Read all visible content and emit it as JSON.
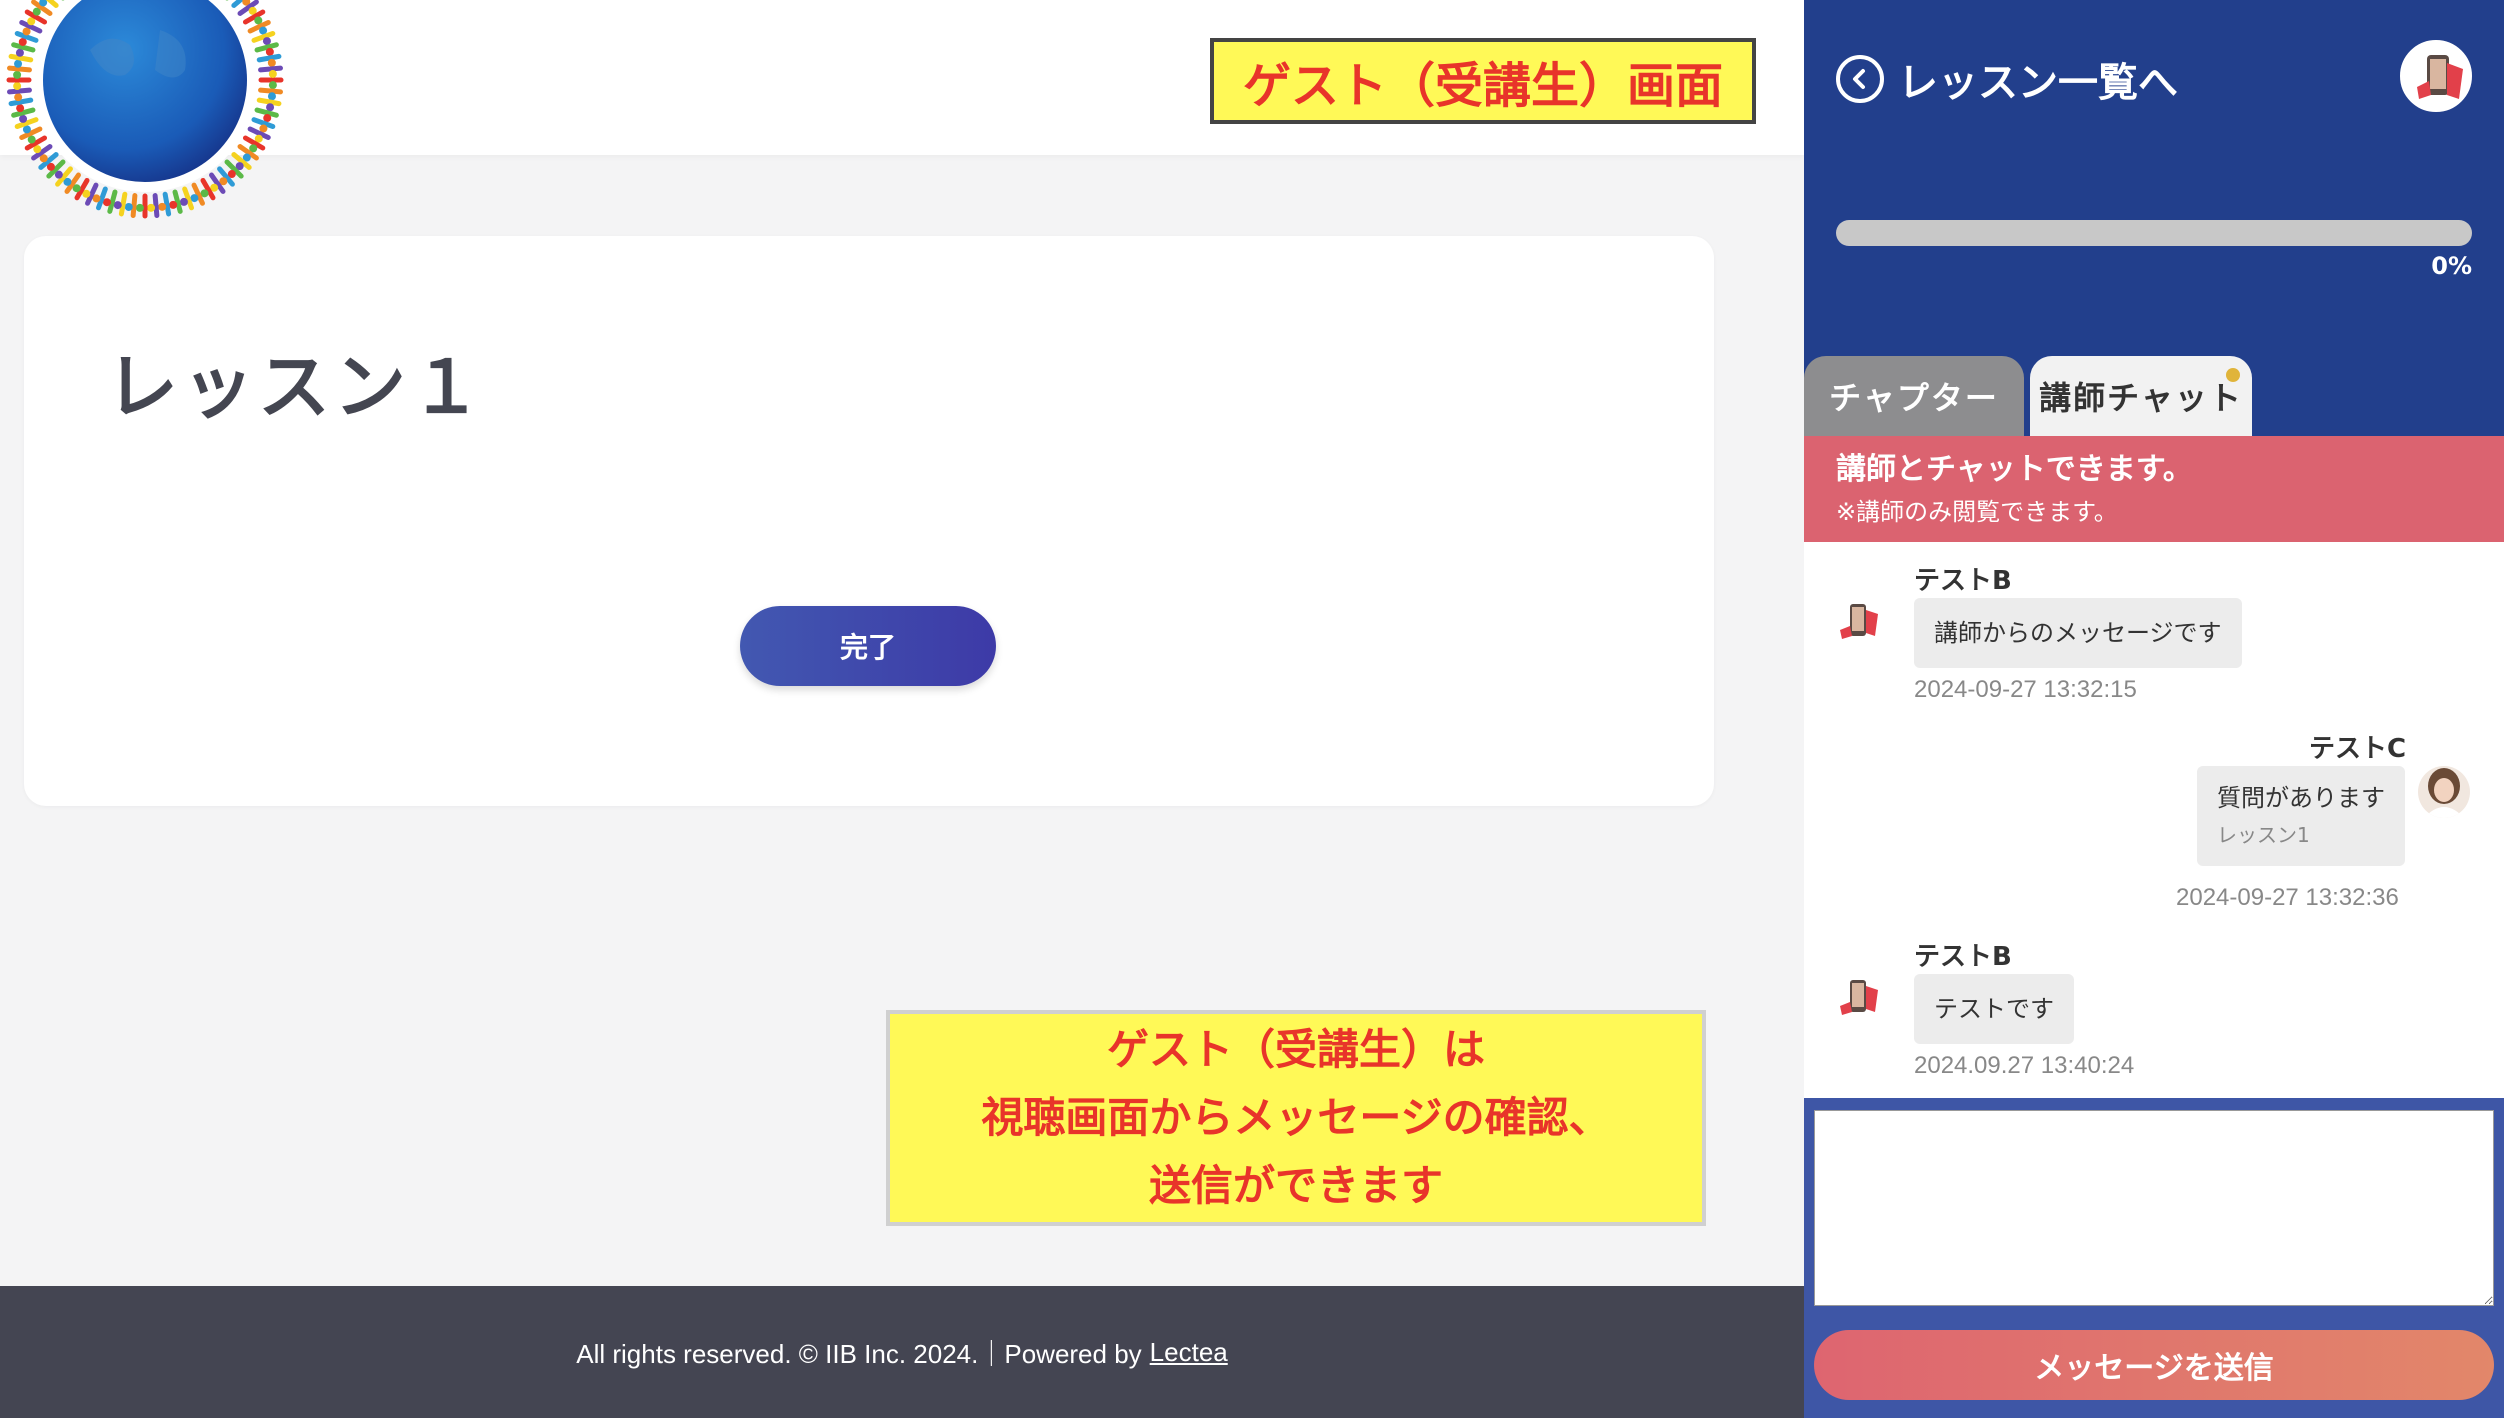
{
  "header": {
    "screen_label": "ゲスト（受講生）画面"
  },
  "lesson": {
    "title": "レッスン１",
    "complete_label": "完了"
  },
  "annotation": {
    "line1": "ゲスト（受講生）は",
    "line2": "視聴画面からメッセージの確認、",
    "line3": "送信ができます"
  },
  "footer": {
    "text": "All rights reserved. © IIB Inc. 2024.｜Powered by",
    "link": "Lectea"
  },
  "sidebar": {
    "back_label": "レッスン一覧へ",
    "progress_value": 0,
    "progress_label": "0%",
    "tabs": [
      {
        "label": "チャプター",
        "active": false
      },
      {
        "label": "講師チャット",
        "active": true
      }
    ],
    "banner": {
      "title": "講師とチャットできます。",
      "note": "※講師のみ閲覧できます。"
    },
    "messages": [
      {
        "sender": "テストB",
        "text": "講師からのメッセージです",
        "time": "2024-09-27 13:32:15",
        "side": "left"
      },
      {
        "sender": "テストC",
        "text": "質問があります",
        "sub": "レッスン1",
        "time": "2024-09-27 13:32:36",
        "side": "right"
      },
      {
        "sender": "テストB",
        "text": "テストです",
        "time": "2024.09.27 13:40:24",
        "side": "left"
      }
    ],
    "input_placeholder": "",
    "send_label": "メッセージを送信"
  },
  "colors": {
    "sidebar_bg": "#223f8c",
    "banner": "#db6370",
    "highlight_yellow": "#fff957",
    "highlight_text": "#e8342a"
  }
}
